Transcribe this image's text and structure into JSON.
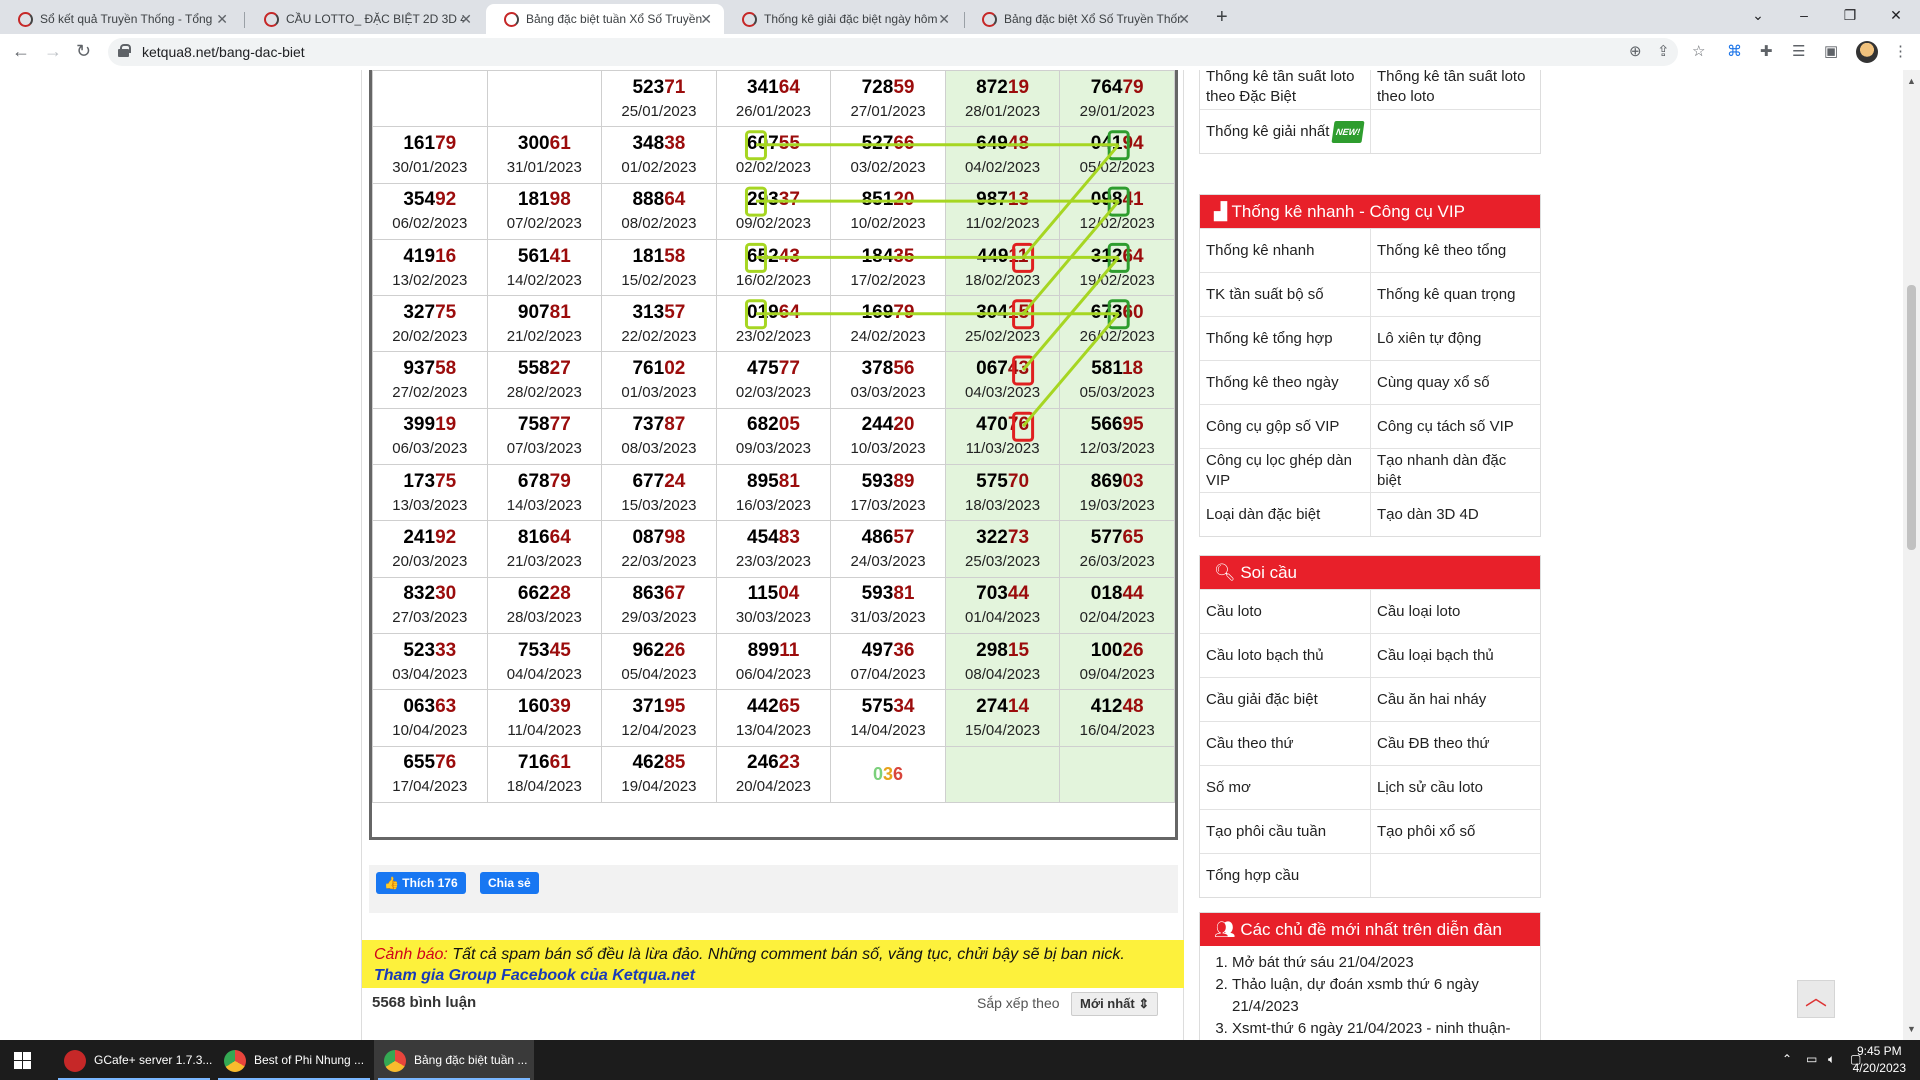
{
  "browser": {
    "tabs": [
      {
        "title": "Sổ kết quả Truyền Thống - Tổng",
        "active": false
      },
      {
        "title": "CẦU LOTTO_ ĐẶC BIỆT 2D 3D 4D",
        "active": false
      },
      {
        "title": "Bảng đặc biệt tuần Xổ Số Truyền",
        "active": true
      },
      {
        "title": "Thống kê giải đặc biệt ngày hôm",
        "active": false
      },
      {
        "title": "Bảng đặc biệt Xổ Số Truyền Thốn",
        "active": false
      }
    ],
    "url": "ketqua8.net/bang-dac-biet"
  },
  "results": {
    "rows": [
      [
        null,
        null,
        {
          "n": "52371",
          "d": "25/01/2023"
        },
        {
          "n": "34164",
          "d": "26/01/2023"
        },
        {
          "n": "72859",
          "d": "27/01/2023"
        },
        {
          "n": "87219",
          "d": "28/01/2023"
        },
        {
          "n": "76479",
          "d": "29/01/2023"
        }
      ],
      [
        {
          "n": "16179",
          "d": "30/01/2023"
        },
        {
          "n": "30061",
          "d": "31/01/2023"
        },
        {
          "n": "34838",
          "d": "01/02/2023"
        },
        {
          "n": "60755",
          "d": "02/02/2023"
        },
        {
          "n": "52766",
          "d": "03/02/2023"
        },
        {
          "n": "64948",
          "d": "04/02/2023"
        },
        {
          "n": "04194",
          "d": "05/02/2023"
        }
      ],
      [
        {
          "n": "35492",
          "d": "06/02/2023"
        },
        {
          "n": "18198",
          "d": "07/02/2023"
        },
        {
          "n": "88864",
          "d": "08/02/2023"
        },
        {
          "n": "29337",
          "d": "09/02/2023"
        },
        {
          "n": "85120",
          "d": "10/02/2023"
        },
        {
          "n": "98713",
          "d": "11/02/2023"
        },
        {
          "n": "09841",
          "d": "12/02/2023"
        }
      ],
      [
        {
          "n": "41916",
          "d": "13/02/2023"
        },
        {
          "n": "56141",
          "d": "14/02/2023"
        },
        {
          "n": "18158",
          "d": "15/02/2023"
        },
        {
          "n": "65243",
          "d": "16/02/2023"
        },
        {
          "n": "18435",
          "d": "17/02/2023"
        },
        {
          "n": "44911",
          "d": "18/02/2023"
        },
        {
          "n": "31264",
          "d": "19/02/2023"
        }
      ],
      [
        {
          "n": "32775",
          "d": "20/02/2023"
        },
        {
          "n": "90781",
          "d": "21/02/2023"
        },
        {
          "n": "31357",
          "d": "22/02/2023"
        },
        {
          "n": "01964",
          "d": "23/02/2023"
        },
        {
          "n": "16979",
          "d": "24/02/2023"
        },
        {
          "n": "30415",
          "d": "25/02/2023"
        },
        {
          "n": "67360",
          "d": "26/02/2023"
        }
      ],
      [
        {
          "n": "93758",
          "d": "27/02/2023"
        },
        {
          "n": "55827",
          "d": "28/02/2023"
        },
        {
          "n": "76102",
          "d": "01/03/2023"
        },
        {
          "n": "47577",
          "d": "02/03/2023"
        },
        {
          "n": "37856",
          "d": "03/03/2023"
        },
        {
          "n": "06743",
          "d": "04/03/2023"
        },
        {
          "n": "58118",
          "d": "05/03/2023"
        }
      ],
      [
        {
          "n": "39919",
          "d": "06/03/2023"
        },
        {
          "n": "75877",
          "d": "07/03/2023"
        },
        {
          "n": "73787",
          "d": "08/03/2023"
        },
        {
          "n": "68205",
          "d": "09/03/2023"
        },
        {
          "n": "24420",
          "d": "10/03/2023"
        },
        {
          "n": "47076",
          "d": "11/03/2023"
        },
        {
          "n": "56695",
          "d": "12/03/2023"
        }
      ],
      [
        {
          "n": "17375",
          "d": "13/03/2023"
        },
        {
          "n": "67879",
          "d": "14/03/2023"
        },
        {
          "n": "67724",
          "d": "15/03/2023"
        },
        {
          "n": "89581",
          "d": "16/03/2023"
        },
        {
          "n": "59389",
          "d": "17/03/2023"
        },
        {
          "n": "57570",
          "d": "18/03/2023"
        },
        {
          "n": "86903",
          "d": "19/03/2023"
        }
      ],
      [
        {
          "n": "24192",
          "d": "20/03/2023"
        },
        {
          "n": "81664",
          "d": "21/03/2023"
        },
        {
          "n": "08798",
          "d": "22/03/2023"
        },
        {
          "n": "45483",
          "d": "23/03/2023"
        },
        {
          "n": "48657",
          "d": "24/03/2023"
        },
        {
          "n": "32273",
          "d": "25/03/2023"
        },
        {
          "n": "57765",
          "d": "26/03/2023"
        }
      ],
      [
        {
          "n": "83230",
          "d": "27/03/2023"
        },
        {
          "n": "66228",
          "d": "28/03/2023"
        },
        {
          "n": "86367",
          "d": "29/03/2023"
        },
        {
          "n": "11504",
          "d": "30/03/2023"
        },
        {
          "n": "59381",
          "d": "31/03/2023"
        },
        {
          "n": "70344",
          "d": "01/04/2023"
        },
        {
          "n": "01844",
          "d": "02/04/2023"
        }
      ],
      [
        {
          "n": "52333",
          "d": "03/04/2023"
        },
        {
          "n": "75345",
          "d": "04/04/2023"
        },
        {
          "n": "96226",
          "d": "05/04/2023"
        },
        {
          "n": "89911",
          "d": "06/04/2023"
        },
        {
          "n": "49736",
          "d": "07/04/2023"
        },
        {
          "n": "29815",
          "d": "08/04/2023"
        },
        {
          "n": "10026",
          "d": "09/04/2023"
        }
      ],
      [
        {
          "n": "06363",
          "d": "10/04/2023"
        },
        {
          "n": "16039",
          "d": "11/04/2023"
        },
        {
          "n": "37195",
          "d": "12/04/2023"
        },
        {
          "n": "44265",
          "d": "13/04/2023"
        },
        {
          "n": "57534",
          "d": "14/04/2023"
        },
        {
          "n": "27414",
          "d": "15/04/2023"
        },
        {
          "n": "41248",
          "d": "16/04/2023"
        }
      ],
      [
        {
          "n": "65576",
          "d": "17/04/2023"
        },
        {
          "n": "71661",
          "d": "18/04/2023"
        },
        {
          "n": "46285",
          "d": "19/04/2023"
        },
        {
          "n": "24623",
          "d": "20/04/2023"
        },
        {
          "cau": "036"
        },
        null,
        null
      ]
    ]
  },
  "social": {
    "like_label": "Thích 176",
    "share_label": "Chia sẻ"
  },
  "warning": {
    "label": "Cảnh báo:",
    "text": " Tất cả spam bán số đều là lừa đảo. Những comment bán số, văng tục, chửi bậy sẽ bị ban nick.",
    "link": "Tham gia Group Facebook của Ketqua.net"
  },
  "comments": {
    "count": "5568 bình luận",
    "sort_label": "Sắp xếp theo",
    "sort_value": "Mới nhất"
  },
  "sidebar": {
    "top_rows": [
      [
        "Thống kê tần suất loto theo Đặc Biệt",
        "Thống kê tần suất loto theo loto"
      ],
      [
        "Thống kê giải nhất",
        ""
      ]
    ],
    "new_badge": "NEW!",
    "vip_title": "Thống kê nhanh - Công cụ VIP",
    "vip_rows": [
      [
        "Thống kê nhanh",
        "Thống kê theo tổng"
      ],
      [
        "TK tần suất bộ số",
        "Thống kê quan trọng"
      ],
      [
        "Thống kê tổng hợp",
        "Lô xiên tự động"
      ],
      [
        "Thống kê theo ngày",
        "Cùng quay xổ số"
      ],
      [
        "Công cụ gộp số VIP",
        "Công cụ tách số VIP"
      ],
      [
        "Công cụ lọc ghép dàn VIP",
        "Tạo nhanh dàn đặc biệt"
      ],
      [
        "Loại dàn đặc biệt",
        "Tạo dàn 3D 4D"
      ]
    ],
    "soicau_title": "Soi cầu",
    "soicau_rows": [
      [
        "Cầu loto",
        "Cầu loại loto"
      ],
      [
        "Cầu loto bạch thủ",
        "Cầu loại bạch thủ"
      ],
      [
        "Cầu giải đặc biệt",
        "Cầu ăn hai nháy"
      ],
      [
        "Cầu theo thứ",
        "Cầu ĐB theo thứ"
      ],
      [
        "Số mơ",
        "Lịch sử cầu loto"
      ],
      [
        "Tạo phôi cầu tuần",
        "Tạo phôi xổ số"
      ],
      [
        "Tổng hợp cầu",
        ""
      ]
    ],
    "forum_title": "Các chủ đề mới nhất trên diễn đàn",
    "forum_items": [
      "Mở bát thứ sáu 21/04/2023",
      "Thảo luận, dự đoán xsmb thứ 6 ngày 21/4/2023",
      "Xsmt-thứ 6 ngày 21/04/2023 - ninh thuận-"
    ]
  },
  "taskbar": {
    "apps": [
      {
        "label": "GCafe+ server 1.7.3...",
        "color": "#c62828"
      },
      {
        "label": "Best of Phi Nhung ...",
        "color": "#e8453c"
      },
      {
        "label": "Bảng đặc biệt tuần ...",
        "color": "#e8453c"
      }
    ],
    "time": "9:45 PM",
    "date": "4/20/2023"
  },
  "colors": {
    "accent_red": "#e8202a",
    "week_green": "#e3f4dc",
    "digit_red": "#9b0c0c",
    "cau_line": "#a6d622",
    "cau_green_box": "#2e9d2e",
    "cau_red_box": "#e02020"
  }
}
